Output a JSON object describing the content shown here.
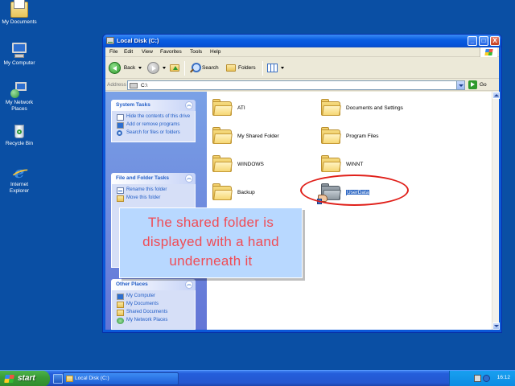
{
  "desktop": {
    "icons": [
      {
        "label": "My Documents",
        "icon": "my-documents-icon"
      },
      {
        "label": "My Computer",
        "icon": "my-computer-icon"
      },
      {
        "label": "My Network Places",
        "icon": "network-places-icon"
      },
      {
        "label": "Recycle Bin",
        "icon": "recycle-bin-icon"
      },
      {
        "label": "Internet Explorer",
        "icon": "internet-explorer-icon"
      }
    ]
  },
  "window": {
    "title": "Local Disk (C:)",
    "controls": {
      "minimize": "_",
      "maximize": "□",
      "close": "X"
    },
    "menu": [
      "File",
      "Edit",
      "View",
      "Favorites",
      "Tools",
      "Help"
    ],
    "toolbar": {
      "back": "Back",
      "search": "Search",
      "folders": "Folders"
    },
    "address": {
      "label": "Address",
      "value": "C:\\",
      "go": "Go"
    },
    "task_pane": {
      "system_tasks": {
        "title": "System Tasks",
        "items": [
          "Hide the contents of this drive",
          "Add or remove programs",
          "Search for files or folders"
        ]
      },
      "file_folder_tasks": {
        "title": "File and Folder Tasks",
        "items": [
          "Rename this folder",
          "Move this folder"
        ]
      },
      "other_places": {
        "title": "Other Places",
        "items": [
          "My Computer",
          "My Documents",
          "Shared Documents",
          "My Network Places"
        ]
      }
    },
    "files": [
      {
        "name": "ATI",
        "shared": false,
        "selected": false
      },
      {
        "name": "Documents and Settings",
        "shared": false,
        "selected": false
      },
      {
        "name": "My Shared Folder",
        "shared": false,
        "selected": false
      },
      {
        "name": "Program Files",
        "shared": false,
        "selected": false
      },
      {
        "name": "WINDOWS",
        "shared": false,
        "selected": false
      },
      {
        "name": "WINNT",
        "shared": false,
        "selected": false
      },
      {
        "name": "Backup",
        "shared": false,
        "selected": false
      },
      {
        "name": "UserData",
        "shared": true,
        "selected": true
      }
    ]
  },
  "callout": {
    "line1": "The shared folder is",
    "line2": "displayed with a hand",
    "line3": "underneath it",
    "text_color": "#f04c55",
    "background": "#b8d8ff"
  },
  "annotation": {
    "color": "#e0201a"
  },
  "taskbar": {
    "start_label": "start",
    "task_button": "Local Disk (C:)",
    "language": "EN",
    "clock": "16:12"
  }
}
